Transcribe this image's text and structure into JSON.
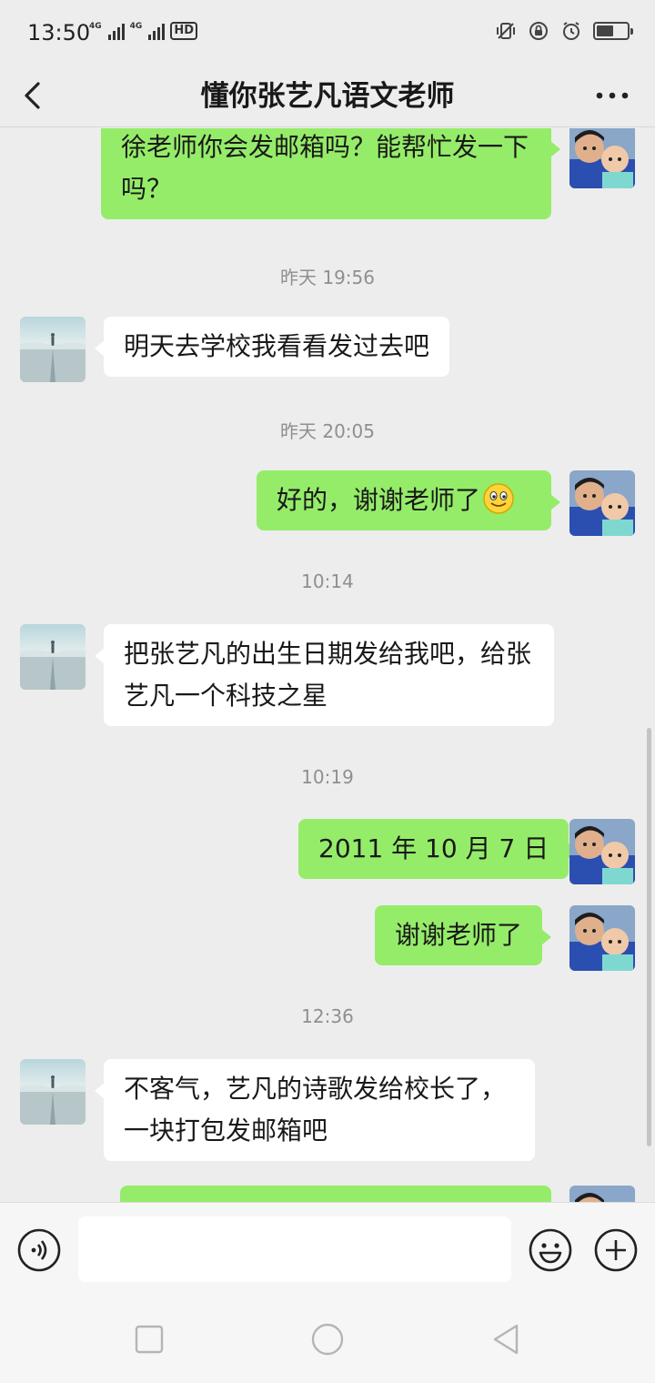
{
  "status_bar": {
    "time": "13:50",
    "network_1": "4G",
    "network_2": "4G",
    "hd": "HD",
    "icons": [
      "vibrate-icon",
      "rotation-lock-icon",
      "alarm-icon",
      "battery-icon"
    ],
    "battery_level": 0.55
  },
  "header": {
    "title": "懂你张艺凡语文老师",
    "back_icon": "chevron-left-icon",
    "more_icon": "more-dots-icon"
  },
  "messages": [
    {
      "sender": "me",
      "text": "徐老师你会发邮箱吗？能帮忙发一下吗？"
    },
    {
      "timestamp": "昨天 19:56"
    },
    {
      "sender": "them",
      "text": "明天去学校我看看发过去吧"
    },
    {
      "timestamp": "昨天 20:05"
    },
    {
      "sender": "me",
      "text": "好的，谢谢老师了",
      "emoji": "smiley-emoji"
    },
    {
      "timestamp": "10:14"
    },
    {
      "sender": "them",
      "text": "把张艺凡的出生日期发给我吧，给张艺凡一个科技之星"
    },
    {
      "timestamp": "10:19"
    },
    {
      "sender": "me",
      "text": "2011 年 10 月 7 日"
    },
    {
      "sender": "me",
      "text": "谢谢老师了"
    },
    {
      "timestamp": "12:36"
    },
    {
      "sender": "them",
      "text": "不客气，艺凡的诗歌发给校长了，一块打包发邮箱吧"
    }
  ],
  "input_bar": {
    "voice_icon": "voice-icon",
    "input_value": "",
    "emoji_icon": "emoji-icon",
    "plus_icon": "plus-icon"
  },
  "nav_bar": {
    "icons": [
      "recent-apps-icon",
      "home-icon",
      "back-triangle-icon"
    ]
  },
  "colors": {
    "background": "#ededed",
    "my_bubble": "#95ec69",
    "their_bubble": "#ffffff",
    "timestamp": "#8f8f8f"
  }
}
